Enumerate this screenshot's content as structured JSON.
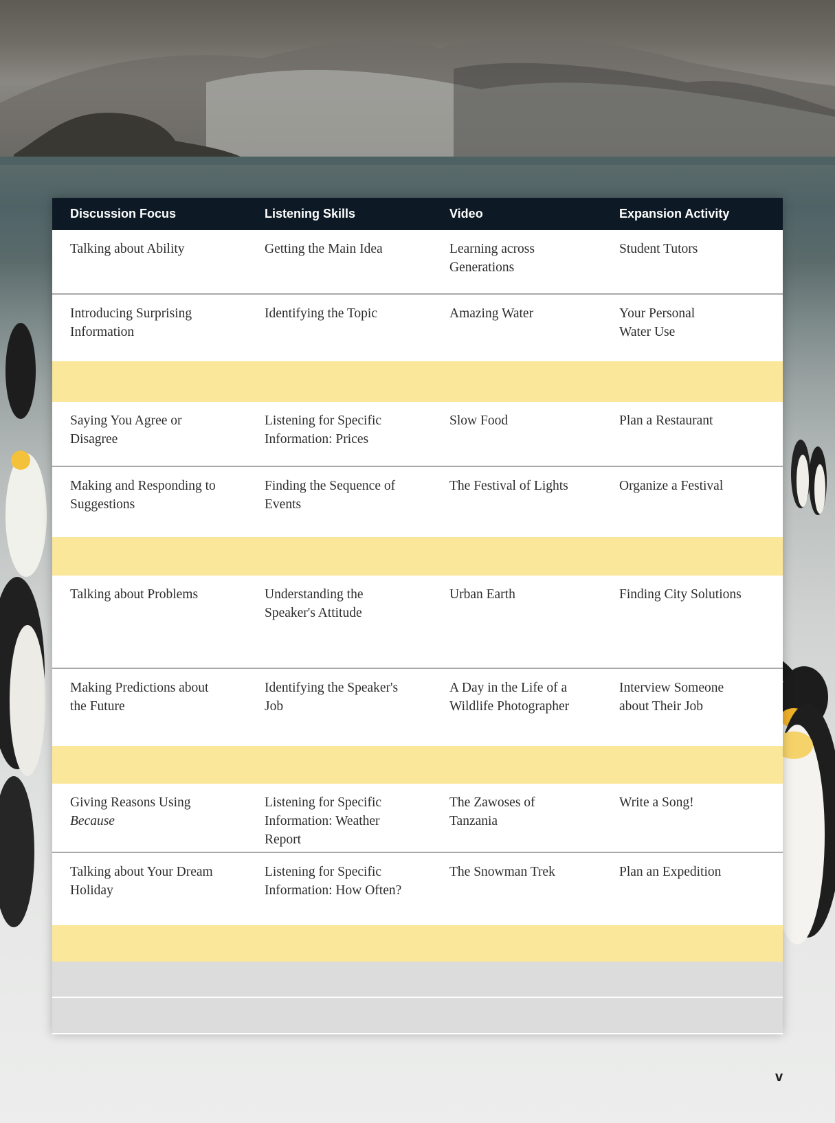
{
  "header": {
    "discussion": "Discussion Focus",
    "listening": "Listening Skills",
    "video": "Video",
    "expansion": "Expansion Activity"
  },
  "rows": [
    {
      "discussion": "Talking about Ability",
      "listening": "Getting the Main Idea",
      "video": "Learning across Generations",
      "expansion": "Student Tutors"
    },
    {
      "discussion": "Introducing Surprising Information",
      "listening": "Identifying the Topic",
      "video": "Amazing Water",
      "expansion": "Your Personal Water Use"
    },
    {
      "discussion": "Saying You Agree or Disagree",
      "listening": "Listening for Specific Information: Prices",
      "video": "Slow Food",
      "expansion": "Plan a Restaurant"
    },
    {
      "discussion": "Making and Responding to Suggestions",
      "listening": "Finding the Sequence of Events",
      "video": "The Festival of Lights",
      "expansion": "Organize a Festival"
    },
    {
      "discussion": "Talking about Problems",
      "listening": "Understanding the Speaker's Attitude",
      "video": "Urban Earth",
      "expansion": "Finding City Solutions"
    },
    {
      "discussion": "Making Predictions about the Future",
      "listening": "Identifying the Speaker's Job",
      "video": "A Day in the Life of a Wildlife Photographer",
      "expansion": "Interview Someone about Their Job"
    },
    {
      "discussion_prefix": "Giving Reasons Using",
      "discussion_italic": "Because",
      "listening": "Listening for Specific Information: Weather Report",
      "video": "The Zawoses of Tanzania",
      "expansion": "Write a Song!"
    },
    {
      "discussion": "Talking about Your Dream Holiday",
      "listening": "Listening for Specific Information: How Often?",
      "video": "The Snowman Trek",
      "expansion": "Plan an Expedition"
    }
  ],
  "page_number": "v",
  "colors": {
    "header_bg": "#0d1a26",
    "band": "#fbe79a",
    "grey_row": "#dcdcdc"
  }
}
